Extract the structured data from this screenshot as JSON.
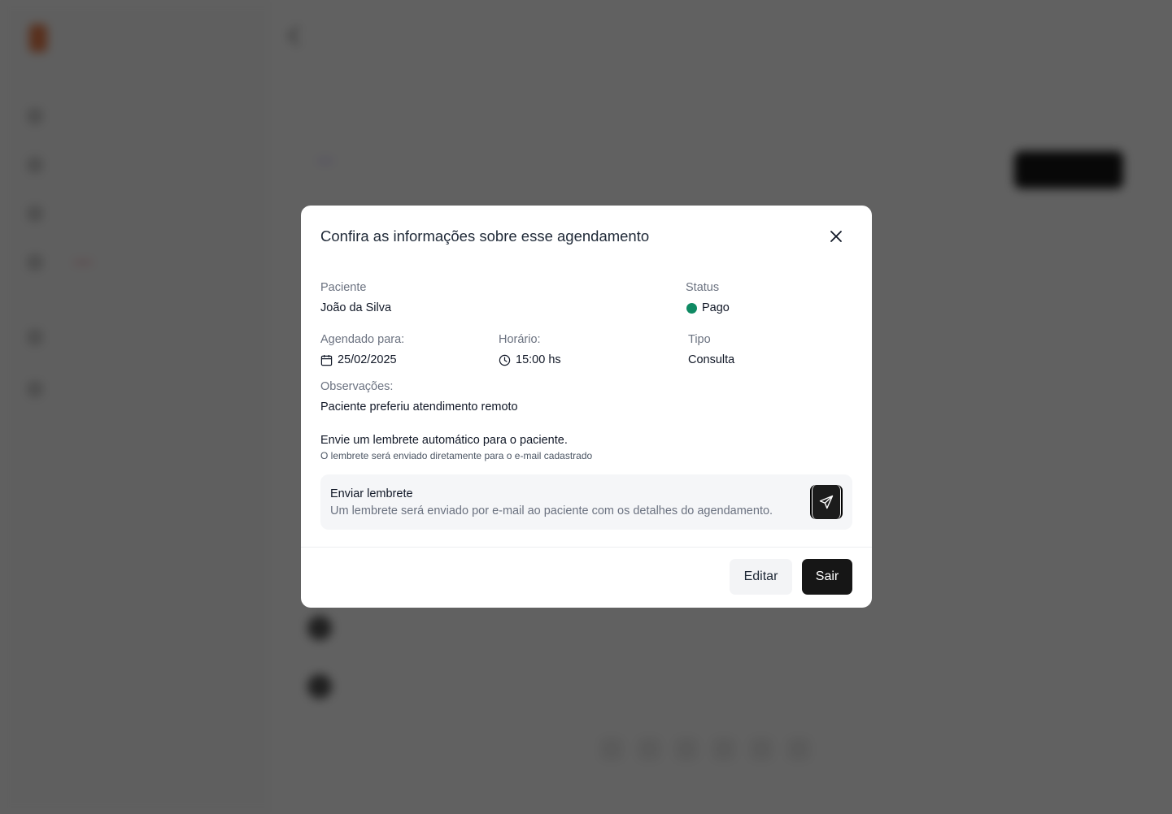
{
  "background": {
    "brand": "",
    "nav_items": [
      {
        "label": ""
      },
      {
        "label": ""
      },
      {
        "label": ""
      },
      {
        "label": ""
      },
      {
        "label": ""
      },
      {
        "label": ""
      }
    ],
    "page_title": "",
    "page_subtitle": "",
    "tab_label": "",
    "tab_count": ""
  },
  "modal": {
    "title": "Confira as informações sobre esse agendamento",
    "fields": {
      "patient_label": "Paciente",
      "patient_value": "João da Silva",
      "status_label": "Status",
      "status_value": "Pago",
      "scheduled_label": "Agendado para:",
      "scheduled_value": "25/02/2025",
      "time_label": "Horário:",
      "time_value": "15:00 hs",
      "type_label": "Tipo",
      "type_value": "Consulta",
      "notes_label": "Observações:",
      "notes_value": "Paciente preferiu atendimento remoto"
    },
    "reminder": {
      "heading": "Envie um lembrete automático para o paciente.",
      "subheading": "O lembrete será enviado diretamente para o e-mail cadastrado",
      "card_title": "Enviar lembrete",
      "card_description": "Um lembrete será enviado por e-mail ao paciente com os detalhes do agendamento.",
      "send_icon": "send-icon"
    },
    "actions": {
      "edit_label": "Editar",
      "exit_label": "Sair"
    }
  },
  "colors": {
    "status_paid": "#0f8a63",
    "primary_button": "#161616",
    "overlay": "rgba(0,0,0,0.62)"
  }
}
